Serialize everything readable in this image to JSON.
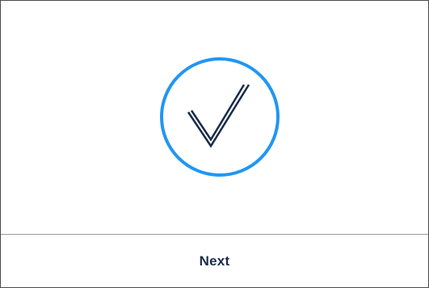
{
  "dialog": {
    "status_icon": "checkmark-circle-icon",
    "next_label": "Next"
  },
  "colors": {
    "circle_stroke": "#2196f3",
    "check_stroke": "#1a2b4a",
    "label": "#1a2b4a"
  }
}
